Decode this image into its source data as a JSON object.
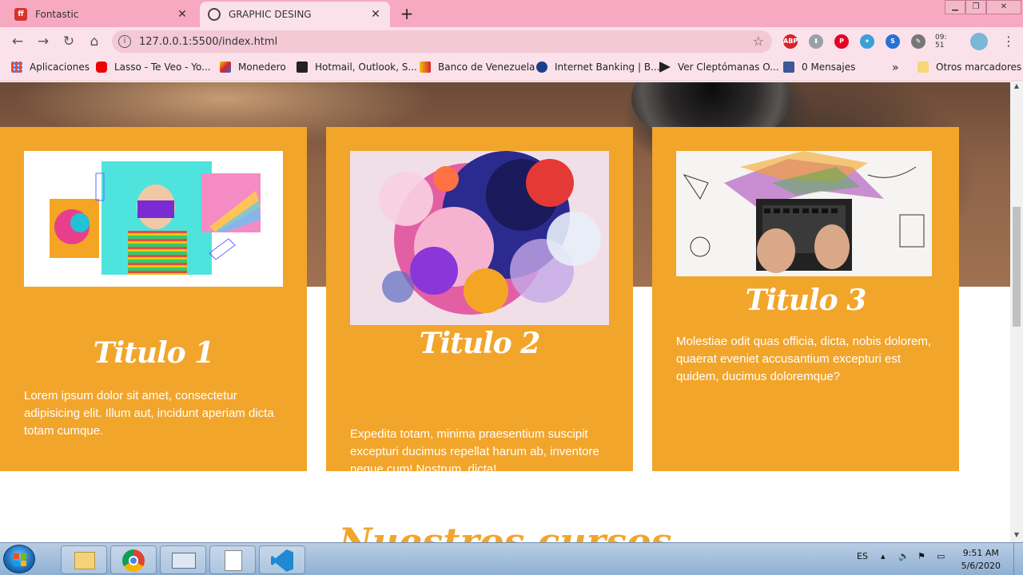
{
  "browser": {
    "tabs": [
      {
        "label": "Fontastic",
        "icon": "fontastic-icon",
        "active": false
      },
      {
        "label": "GRAPHIC DESING",
        "icon": "globe-icon",
        "active": true
      }
    ],
    "url": "127.0.0.1:5500/index.html",
    "clock_widget": "09:\n51",
    "bookmarks": [
      {
        "label": "Aplicaciones",
        "icon": "apps-grid-icon"
      },
      {
        "label": "Lasso - Te Veo - Yo...",
        "icon": "youtube-icon"
      },
      {
        "label": "Monedero",
        "icon": "monedero-icon"
      },
      {
        "label": "Hotmail, Outlook, S...",
        "icon": "hotmail-icon"
      },
      {
        "label": "Banco de Venezuela",
        "icon": "bank-icon"
      },
      {
        "label": "Internet Banking | B...",
        "icon": "internet-banking-icon"
      },
      {
        "label": "Ver Cleptómanas O...",
        "icon": "play-icon"
      },
      {
        "label": "0 Mensajes",
        "icon": "facebook-icon"
      },
      {
        "label": "Otros marcadores",
        "icon": "folder-icon"
      }
    ],
    "overflow": "»"
  },
  "page": {
    "cards": [
      {
        "title": "Titulo 1",
        "text": "Lorem ipsum dolor sit amet, consectetur adipisicing elit. Illum aut, incidunt aperiam dicta totam cumque."
      },
      {
        "title": "Titulo 2",
        "text": "Expedita totam, minima praesentium suscipit excepturi ducimus repellat harum ab, inventore neque cum! Nostrum, dicta!"
      },
      {
        "title": "Titulo 3",
        "text": "Molestiae odit quas officia, dicta, nobis dolorem, quaerat eveniet accusantium excepturi est quidem, ducimus doloremque?"
      }
    ],
    "section_title": "Nuestros cursos"
  },
  "taskbar": {
    "lang": "ES",
    "time": "9:51 AM",
    "date": "5/6/2020"
  },
  "colors": {
    "accent": "#f2a52b",
    "tabstrip": "#f7a9c1",
    "toolbar": "#fbe2ea"
  }
}
